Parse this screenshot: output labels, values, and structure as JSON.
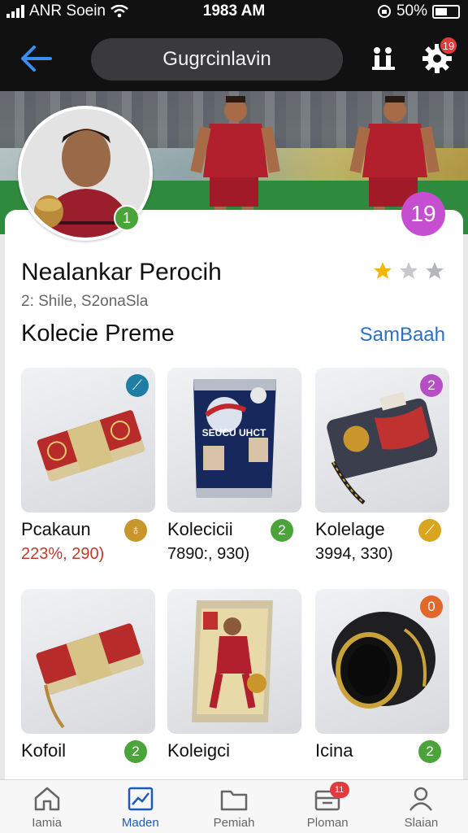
{
  "status_bar": {
    "carrier": "ANR Soein",
    "time": "1983 AM",
    "battery": "50%"
  },
  "header": {
    "title": "Gugrcinlavin",
    "notification_count": "19"
  },
  "banner": {
    "rank": "19"
  },
  "profile": {
    "name": "Nealankar Perocih",
    "subtitle": "2: Shile, S2onaSla",
    "level": "1",
    "rating": {
      "filled": 1,
      "total": 3
    }
  },
  "section": {
    "title": "Kolecie Preme",
    "see_all": "SamBaah"
  },
  "items": [
    {
      "name": "Pcakaun",
      "price": "223%, 290)",
      "price_color": "#c0392b",
      "corner_badge": "⟋",
      "corner_color": "#1f7ea3",
      "name_badge": "♁",
      "name_badge_color": "#c9962c"
    },
    {
      "name": "Kolecicii",
      "price": "7890:, 930)",
      "price_color": "#111111",
      "corner_badge": "",
      "corner_color": "",
      "name_badge": "2",
      "name_badge_color": "#4aa43a"
    },
    {
      "name": "Kolelage",
      "price": "3994, 330)",
      "price_color": "#111111",
      "corner_badge": "2",
      "corner_color": "#b64fc5",
      "name_badge": "⟋",
      "name_badge_color": "#d9a51f"
    },
    {
      "name": "Kofoil",
      "price": "",
      "price_color": "#8a2b8a",
      "corner_badge": "",
      "corner_color": "",
      "name_badge": "2",
      "name_badge_color": "#4aa43a"
    },
    {
      "name": "Koleigci",
      "price": "",
      "price_color": "#111111",
      "corner_badge": "",
      "corner_color": "",
      "name_badge": "",
      "name_badge_color": ""
    },
    {
      "name": "Icina",
      "price": "",
      "price_color": "#111111",
      "corner_badge": "0",
      "corner_color": "#e2672b",
      "name_badge": "2",
      "name_badge_color": "#4aa43a"
    }
  ],
  "item_art": {
    "pack_text": "SEUCU UHCT"
  },
  "nav": [
    {
      "label": "Iamia",
      "icon": "home-icon"
    },
    {
      "label": "Maden",
      "icon": "chart-icon"
    },
    {
      "label": "Pemiah",
      "icon": "folder-icon"
    },
    {
      "label": "Ploman",
      "icon": "box-icon",
      "badge": "11"
    },
    {
      "label": "Slaian",
      "icon": "user-icon"
    }
  ],
  "colors": {
    "accent": "#2a6fc7",
    "dark": "#111111",
    "active_nav": "#1e5bb8"
  }
}
